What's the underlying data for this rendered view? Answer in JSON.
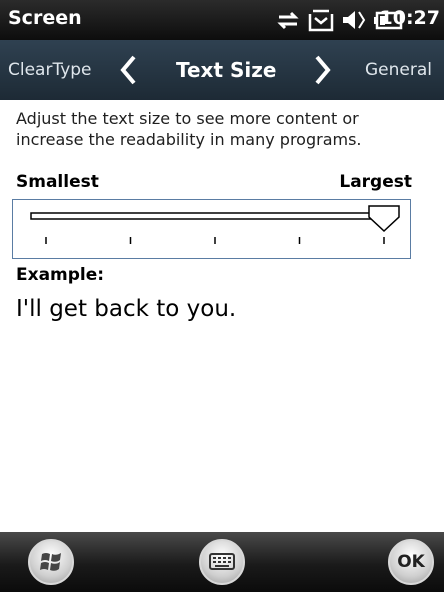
{
  "status_bar": {
    "title": "Screen",
    "time": "10:27",
    "icons": [
      "data-sync-icon",
      "message-icon",
      "volume-icon",
      "battery-icon"
    ]
  },
  "tab_bar": {
    "prev_tab": "ClearType",
    "current_tab": "Text Size",
    "next_tab": "General"
  },
  "content": {
    "description": "Adjust the text size to see more content or increase the readability in many programs.",
    "min_label": "Smallest",
    "max_label": "Largest",
    "slider": {
      "steps": 5,
      "selected_index": 4
    },
    "example_label": "Example:",
    "example_text": "I'll get back to you."
  },
  "bottom_bar": {
    "ok_label": "OK"
  }
}
